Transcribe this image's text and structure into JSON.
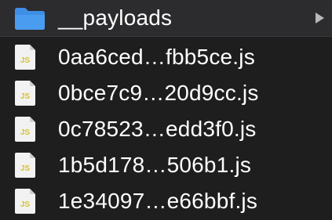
{
  "folder": {
    "name": "__payloads",
    "icon": "folder-icon",
    "expand_icon": "chevron-right-icon",
    "icon_color": "#3f8ee6"
  },
  "files": [
    {
      "name": "0aa6ced…fbb5ce.js",
      "icon": "js-file-icon",
      "icon_text": "JS"
    },
    {
      "name": "0bce7c9…20d9cc.js",
      "icon": "js-file-icon",
      "icon_text": "JS"
    },
    {
      "name": "0c78523…edd3f0.js",
      "icon": "js-file-icon",
      "icon_text": "JS"
    },
    {
      "name": "1b5d178…506b1.js",
      "icon": "js-file-icon",
      "icon_text": "JS"
    },
    {
      "name": "1e34097…e66bbf.js",
      "icon": "js-file-icon",
      "icon_text": "JS"
    }
  ],
  "colors": {
    "background": "#1e1e1e",
    "folder_row": "#2c2c2e",
    "text": "#ffffff",
    "js_badge_text": "#d2c23a",
    "file_icon_body": "#f2f2f2"
  }
}
